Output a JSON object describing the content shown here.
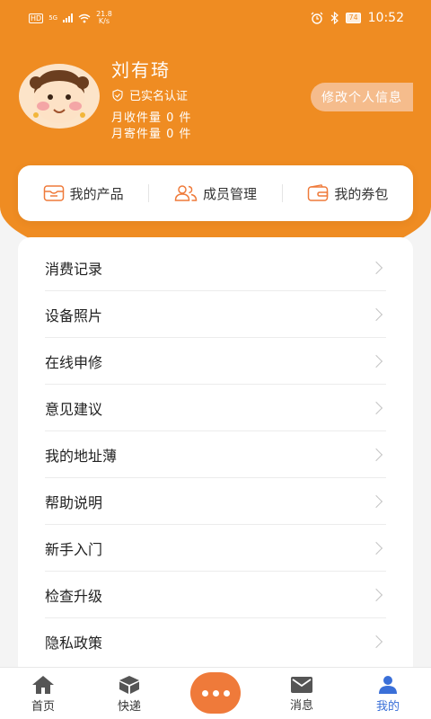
{
  "status_bar": {
    "hd": "HD",
    "network": "5G",
    "speed_value": "21.8",
    "speed_unit": "K/s",
    "battery": "74",
    "time": "10:52"
  },
  "profile": {
    "name": "刘有琦",
    "verified_label": "已实名认证",
    "monthly_received": "月收件量 0 件",
    "monthly_sent": "月寄件量 0 件",
    "edit_label": "修改个人信息"
  },
  "quick_actions": [
    {
      "label": "我的产品",
      "icon": "product-box-icon"
    },
    {
      "label": "成员管理",
      "icon": "members-icon"
    },
    {
      "label": "我的券包",
      "icon": "wallet-icon"
    }
  ],
  "menu": [
    {
      "label": "消费记录"
    },
    {
      "label": "设备照片"
    },
    {
      "label": "在线申修"
    },
    {
      "label": "意见建议"
    },
    {
      "label": "我的地址薄"
    },
    {
      "label": "帮助说明"
    },
    {
      "label": "新手入门"
    },
    {
      "label": "检查升级"
    },
    {
      "label": "隐私政策"
    }
  ],
  "tabbar": {
    "tabs": [
      {
        "label": "首页",
        "icon": "home-icon"
      },
      {
        "label": "快递",
        "icon": "package-icon"
      },
      {
        "label": "消息",
        "icon": "mail-icon"
      },
      {
        "label": "我的",
        "icon": "person-icon",
        "active": true
      }
    ],
    "center_icon": "more-dots-icon"
  },
  "colors": {
    "brand_orange": "#ef8c22",
    "active_tab": "#3a6fd8",
    "center_button": "#ef7a3a"
  }
}
